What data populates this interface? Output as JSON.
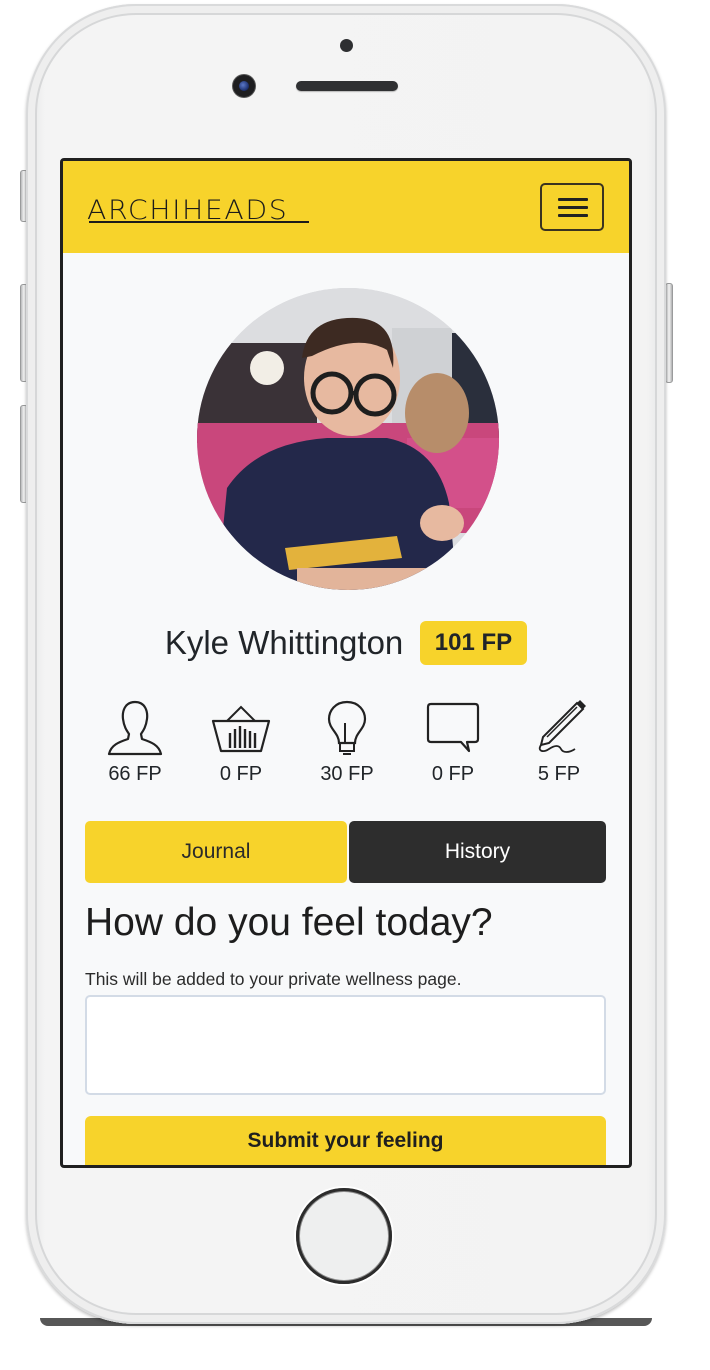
{
  "app": {
    "brand": "ARCHIHEADS",
    "menu_icon": "hamburger-menu-icon",
    "theme": {
      "accent": "#f7d32b",
      "dark": "#2d2d2d",
      "text": "#212529"
    }
  },
  "profile": {
    "avatar_alt": "Profile photo of Kyle Whittington",
    "name": "Kyle Whittington",
    "total_points": "101 FP"
  },
  "stats": [
    {
      "icon": "person-icon",
      "value": "66 FP"
    },
    {
      "icon": "basket-icon",
      "value": "0 FP"
    },
    {
      "icon": "lightbulb-icon",
      "value": "30 FP"
    },
    {
      "icon": "speech-bubble-icon",
      "value": "0 FP"
    },
    {
      "icon": "pencil-signature-icon",
      "value": "5 FP"
    }
  ],
  "tabs": [
    {
      "label": "Journal",
      "active": true
    },
    {
      "label": "History",
      "active": false
    }
  ],
  "journal": {
    "question": "How do you feel today?",
    "hint": "This will be added to your private wellness page.",
    "input_value": "",
    "input_placeholder": "",
    "submit_label": "Submit your feeling"
  }
}
